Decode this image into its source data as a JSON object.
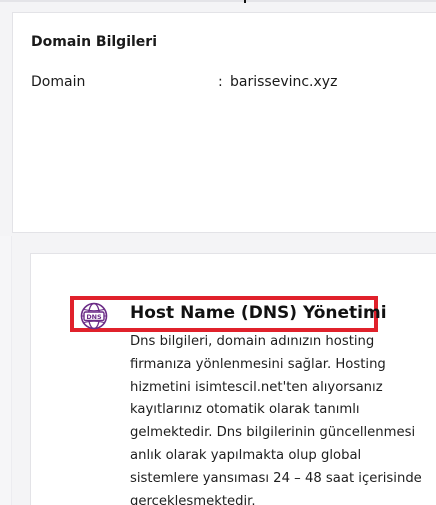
{
  "domain_card": {
    "title": "Domain Bilgileri",
    "label": "Domain",
    "separator": ":",
    "value": "barissevinc.xyz"
  },
  "dns_card": {
    "icon": "globe-dns-icon",
    "icon_text": "DNS",
    "title": "Host Name (DNS) Yönetimi",
    "description": "Dns bilgileri, domain adınızın hosting firmanıza yönlenmesini sağlar. Hosting hizmetini isimtescil.net'ten alıyorsanız kayıtlarınız otomatik olarak tanımlı gelmektedir. Dns bilgilerinin güncellenmesi anlık olarak yapılmakta olup global sistemlere yansıması 24 – 48 saat içerisinde gerçekleşmektedir."
  },
  "colors": {
    "highlight": "#e0212b",
    "icon_purple": "#6a2b86"
  }
}
